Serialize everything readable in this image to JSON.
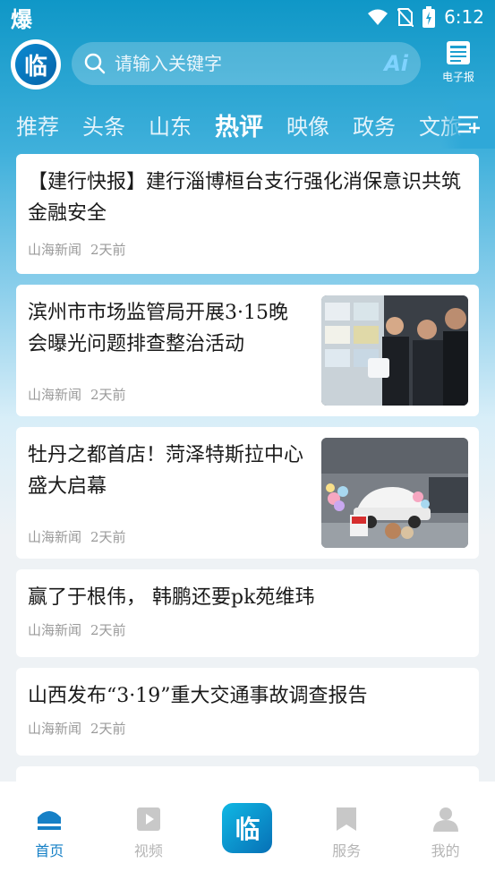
{
  "status_bar": {
    "left_text": "爆",
    "time": "6:12"
  },
  "header": {
    "logo_text": "临",
    "search_placeholder": "请输入关键字",
    "ai_label": "Ai",
    "epaper_label": "电子报"
  },
  "tabs": [
    "推荐",
    "头条",
    "山东",
    "热评",
    "映像",
    "政务",
    "文旅"
  ],
  "active_tab": "热评",
  "articles": [
    {
      "title": "【建行快报】建行淄博桓台支行强化消保意识共筑金融安全",
      "source": "山海新闻",
      "time": "2天前",
      "has_image": false
    },
    {
      "title": "滨州市市场监管局开展3·15晚会曝光问题排查整治活动",
      "source": "山海新闻",
      "time": "2天前",
      "has_image": true
    },
    {
      "title": " 牡丹之都首店！菏泽特斯拉中心盛大启幕",
      "source": "山海新闻",
      "time": "2天前",
      "has_image": true
    },
    {
      "title": "赢了于根伟， 韩鹏还要pk苑维玮",
      "source": "山海新闻",
      "time": "2天前",
      "has_image": false
    },
    {
      "title": "山西发布“3·19”重大交通事故调查报告",
      "source": "山海新闻",
      "time": "2天前",
      "has_image": false
    }
  ],
  "bottom_nav": [
    {
      "label": "首页",
      "icon": "home-icon",
      "active": true
    },
    {
      "label": "视频",
      "icon": "video-icon",
      "active": false
    },
    {
      "label": "临",
      "icon": "center-logo-icon",
      "active": false
    },
    {
      "label": "服务",
      "icon": "service-icon",
      "active": false
    },
    {
      "label": "我的",
      "icon": "profile-icon",
      "active": false
    }
  ],
  "colors": {
    "accent": "#1680c6",
    "header_bg": "#0f97c7",
    "muted": "#9a9a9a"
  }
}
